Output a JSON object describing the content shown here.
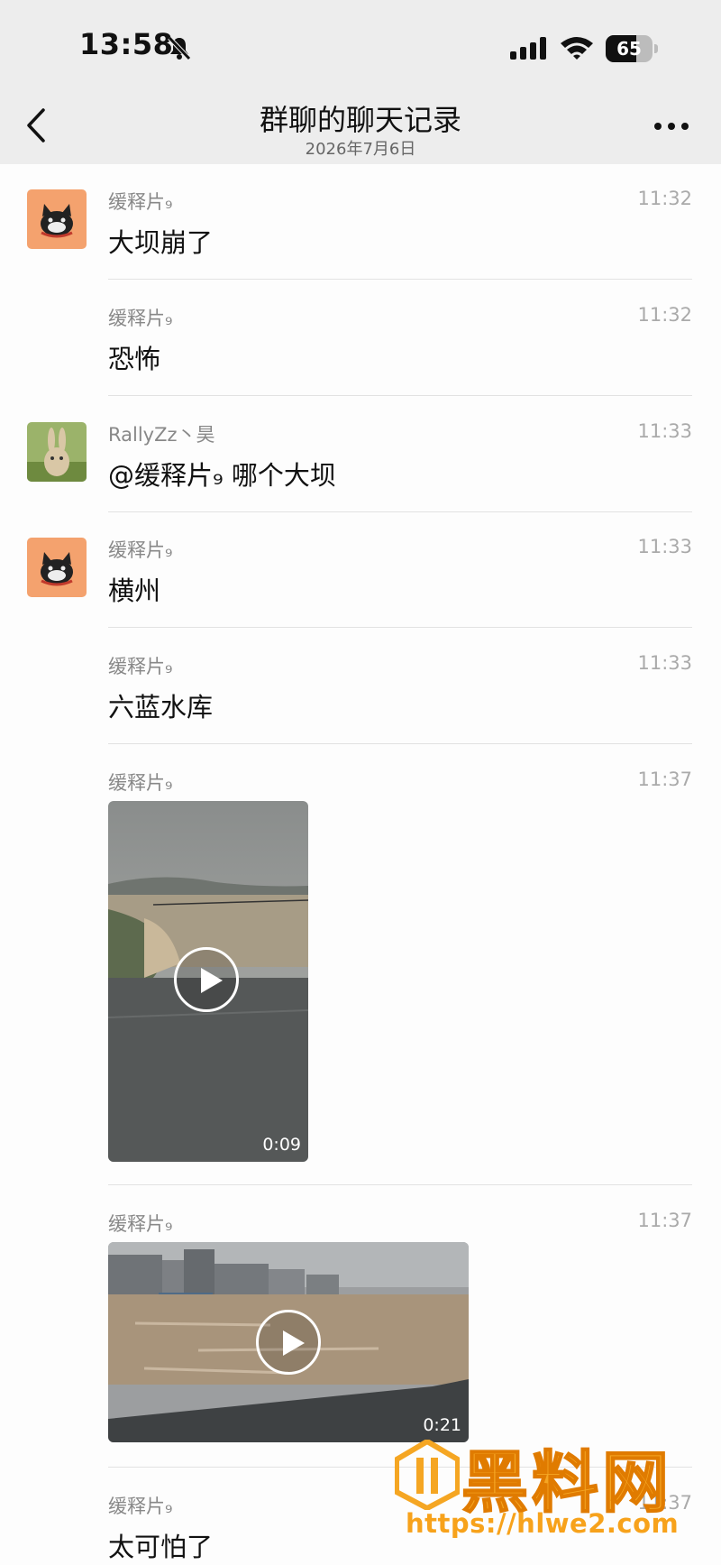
{
  "status_bar": {
    "time": "13:58",
    "battery": "65",
    "battery_level": 0.65
  },
  "nav": {
    "title": "群聊的聊天记录",
    "subtitle": "2026年7月6日"
  },
  "messages": [
    {
      "sender": "缓释片₉",
      "time": "11:32",
      "text": "大坝崩了",
      "avatar": "cat-avatar"
    },
    {
      "sender": "缓释片₉",
      "time": "11:32",
      "text": "恐怖"
    },
    {
      "sender": "RallyZz丶昊",
      "time": "11:33",
      "text": "@缓释片₉ 哪个大坝",
      "avatar": "rabbit-avatar"
    },
    {
      "sender": "缓释片₉",
      "time": "11:33",
      "text": "横州",
      "avatar": "cat-avatar"
    },
    {
      "sender": "缓释片₉",
      "time": "11:33",
      "text": "六蓝水库"
    },
    {
      "sender": "缓释片₉",
      "time": "11:37",
      "video_duration": "0:09"
    },
    {
      "sender": "缓释片₉",
      "time": "11:37",
      "video_duration": "0:21"
    },
    {
      "sender": "缓释片₉",
      "time": "11:37",
      "text": "太可怕了"
    }
  ],
  "watermark": {
    "brand": "黑料网",
    "url": "https://hlwe2.com"
  },
  "colors": {
    "nav_bg": "#ededed",
    "avatar_orange": "#f4a26e",
    "watermark": "#f5a623"
  }
}
